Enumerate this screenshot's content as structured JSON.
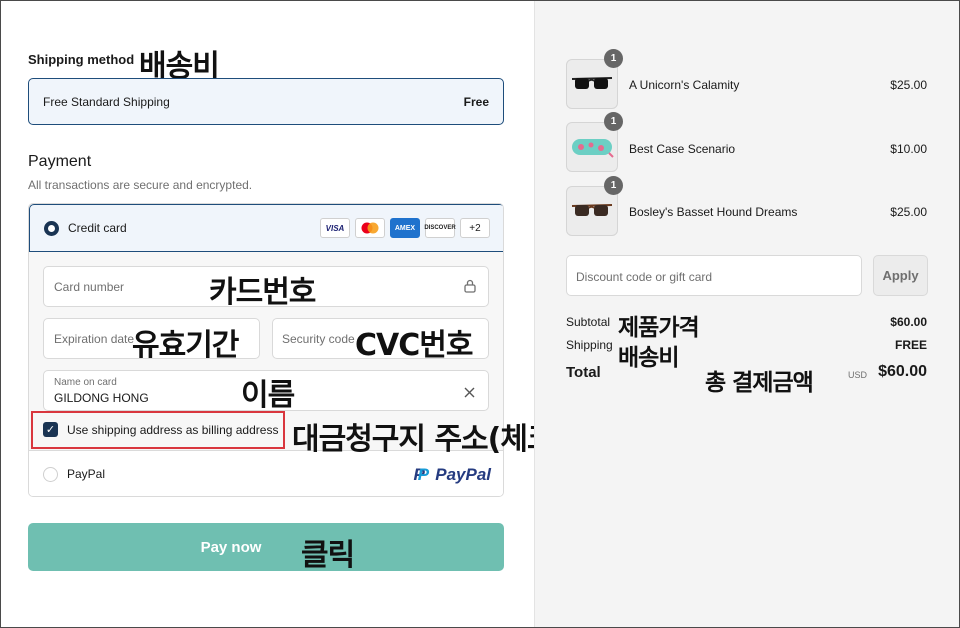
{
  "shipping": {
    "label": "Shipping method",
    "annotation": "배송비",
    "option_name": "Free Standard Shipping",
    "option_price": "Free"
  },
  "payment": {
    "title": "Payment",
    "subtitle": "All transactions are secure and encrypted.",
    "credit_card": {
      "label": "Credit card",
      "brands": [
        "VISA",
        "MC",
        "AMEX",
        "DISCOVER"
      ],
      "more": "+2"
    },
    "card_number": {
      "placeholder": "Card number",
      "annotation": "카드번호"
    },
    "expiration": {
      "placeholder": "Expiration date",
      "annotation": "유효기간"
    },
    "security": {
      "placeholder": "Security code",
      "annotation": "CVC번호"
    },
    "name_on_card": {
      "label": "Name on card",
      "value": "GILDONG HONG",
      "annotation": "이름"
    },
    "billing": {
      "label": "Use shipping address as billing address",
      "checked": true,
      "annotation": "대금청구지 주소(체크o)"
    },
    "paypal": {
      "label": "PayPal",
      "logo_text": "PayPal"
    },
    "pay_button": {
      "label": "Pay now",
      "annotation": "클릭"
    }
  },
  "cart": {
    "items": [
      {
        "name": "A Unicorn's Calamity",
        "price": "$25.00",
        "qty": "1"
      },
      {
        "name": "Best Case Scenario",
        "price": "$10.00",
        "qty": "1"
      },
      {
        "name": "Bosley's Basset Hound Dreams",
        "price": "$25.00",
        "qty": "1"
      }
    ],
    "discount_placeholder": "Discount code or gift card",
    "apply_label": "Apply",
    "subtotal_label": "Subtotal",
    "subtotal_annotation": "제품가격",
    "subtotal_value": "$60.00",
    "shipping_label": "Shipping",
    "shipping_annotation": "배송비",
    "shipping_value": "FREE",
    "total_label": "Total",
    "total_annotation": "총 결제금액",
    "total_currency": "USD",
    "total_value": "$60.00"
  },
  "colors": {
    "accent": "#1e4d7b",
    "pay_button": "#6fbfb1",
    "annotation_box": "#d9363e"
  }
}
